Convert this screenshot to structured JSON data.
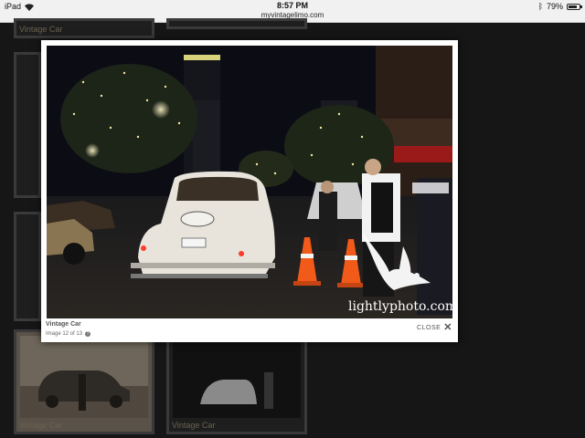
{
  "statusbar": {
    "device": "iPad",
    "time": "8:57 PM",
    "url": "myvintagelimo.com",
    "battery": "79%",
    "battery_level": 0.79,
    "icons": [
      "wifi-icon",
      "bluetooth-icon",
      "battery-icon"
    ]
  },
  "background": {
    "captions": [
      "Vintage Car",
      "Vintage Car",
      "Vintage Car"
    ]
  },
  "lightbox": {
    "title": "Vintage Car",
    "counter": "Image 12 of 13",
    "info_symbol": "?",
    "close_label": "CLOSE",
    "close_symbol": "✕",
    "watermark": "lightlyphoto.com"
  }
}
